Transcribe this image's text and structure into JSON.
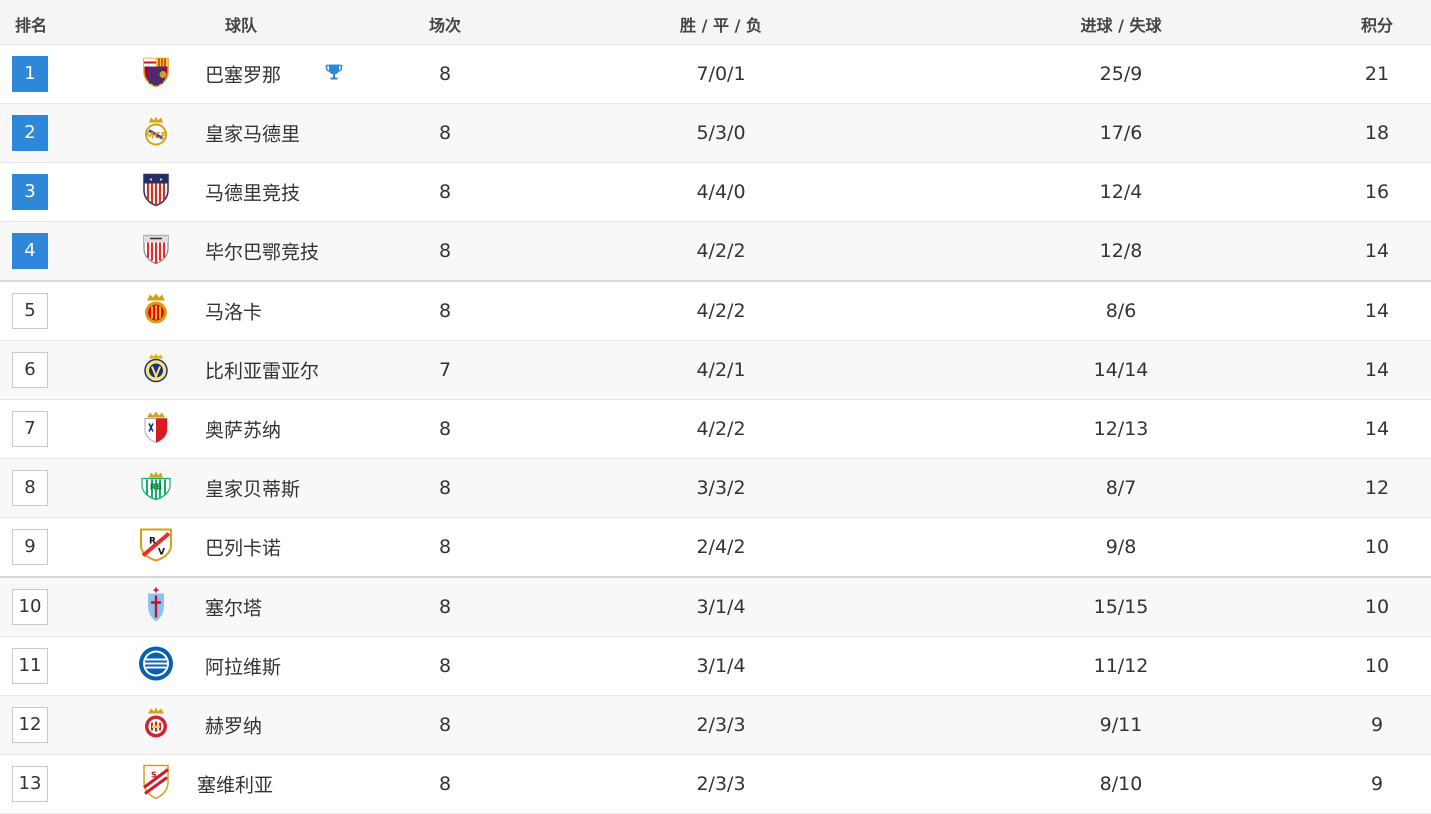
{
  "header": {
    "rank": "排名",
    "team": "球队",
    "played": "场次",
    "wdl": "胜 / 平 / 负",
    "goals": "进球 / 失球",
    "points": "积分"
  },
  "colors": {
    "accent": "#2e87d8"
  },
  "rows": [
    {
      "rank": "1",
      "team": "巴塞罗那",
      "played": "8",
      "wdl": "7/0/1",
      "goals": "25/9",
      "points": "21",
      "badge_icon": "barcelona-crest-icon",
      "trophy": true
    },
    {
      "rank": "2",
      "team": "皇家马德里",
      "played": "8",
      "wdl": "5/3/0",
      "goals": "17/6",
      "points": "18",
      "badge_icon": "real-madrid-crest-icon"
    },
    {
      "rank": "3",
      "team": "马德里竞技",
      "played": "8",
      "wdl": "4/4/0",
      "goals": "12/4",
      "points": "16",
      "badge_icon": "atletico-madrid-crest-icon"
    },
    {
      "rank": "4",
      "team": "毕尔巴鄂竞技",
      "played": "8",
      "wdl": "4/2/2",
      "goals": "12/8",
      "points": "14",
      "badge_icon": "athletic-bilbao-crest-icon"
    },
    {
      "rank": "5",
      "team": "马洛卡",
      "played": "8",
      "wdl": "4/2/2",
      "goals": "8/6",
      "points": "14",
      "badge_icon": "mallorca-crest-icon"
    },
    {
      "rank": "6",
      "team": "比利亚雷亚尔",
      "played": "7",
      "wdl": "4/2/1",
      "goals": "14/14",
      "points": "14",
      "badge_icon": "villarreal-crest-icon"
    },
    {
      "rank": "7",
      "team": "奥萨苏纳",
      "played": "8",
      "wdl": "4/2/2",
      "goals": "12/13",
      "points": "14",
      "badge_icon": "osasuna-crest-icon"
    },
    {
      "rank": "8",
      "team": "皇家贝蒂斯",
      "played": "8",
      "wdl": "3/3/2",
      "goals": "8/7",
      "points": "12",
      "badge_icon": "real-betis-crest-icon"
    },
    {
      "rank": "9",
      "team": "巴列卡诺",
      "played": "8",
      "wdl": "2/4/2",
      "goals": "9/8",
      "points": "10",
      "badge_icon": "rayo-vallecano-crest-icon"
    },
    {
      "rank": "10",
      "team": "塞尔塔",
      "played": "8",
      "wdl": "3/1/4",
      "goals": "15/15",
      "points": "10",
      "badge_icon": "celta-vigo-crest-icon"
    },
    {
      "rank": "11",
      "team": "阿拉维斯",
      "played": "8",
      "wdl": "3/1/4",
      "goals": "11/12",
      "points": "10",
      "badge_icon": "alaves-crest-icon"
    },
    {
      "rank": "12",
      "team": "赫罗纳",
      "played": "8",
      "wdl": "2/3/3",
      "goals": "9/11",
      "points": "9",
      "badge_icon": "girona-crest-icon"
    },
    {
      "rank": "13",
      "team": "塞维利亚",
      "played": "8",
      "wdl": "2/3/3",
      "goals": "8/10",
      "points": "9",
      "badge_icon": "sevilla-crest-icon"
    }
  ]
}
